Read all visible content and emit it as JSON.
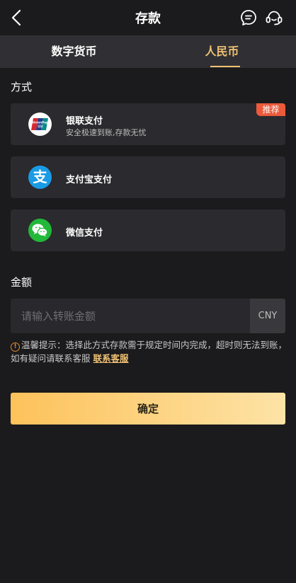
{
  "header": {
    "title": "存款",
    "back_icon": "chevron-left-icon",
    "chat_icon": "chat-bubble-icon",
    "service_icon": "headset-icon"
  },
  "tabs": [
    {
      "label": "数字货币",
      "active": false
    },
    {
      "label": "人民币",
      "active": true
    }
  ],
  "methods_section": {
    "label": "方式",
    "items": [
      {
        "title": "银联支付",
        "subtitle": "安全极速到账,存款无忧",
        "badge": "推荐",
        "icon": "unionpay-icon"
      },
      {
        "title": "支付宝支付",
        "icon": "alipay-icon"
      },
      {
        "title": "微信支付",
        "icon": "wechat-icon"
      }
    ]
  },
  "amount_section": {
    "label": "金额",
    "placeholder": "请输入转账金额",
    "value": "",
    "currency": "CNY"
  },
  "tip": {
    "text": "温馨提示：选择此方式存款需于规定时间内完成，超时则无法到账，如有疑问请联系客服",
    "link": "联系客服"
  },
  "confirm_button": "确定",
  "colors": {
    "accent": "#f0c274",
    "background": "#1b1a1c",
    "card": "#2b2a2e",
    "badge": "#ec5a3b"
  }
}
